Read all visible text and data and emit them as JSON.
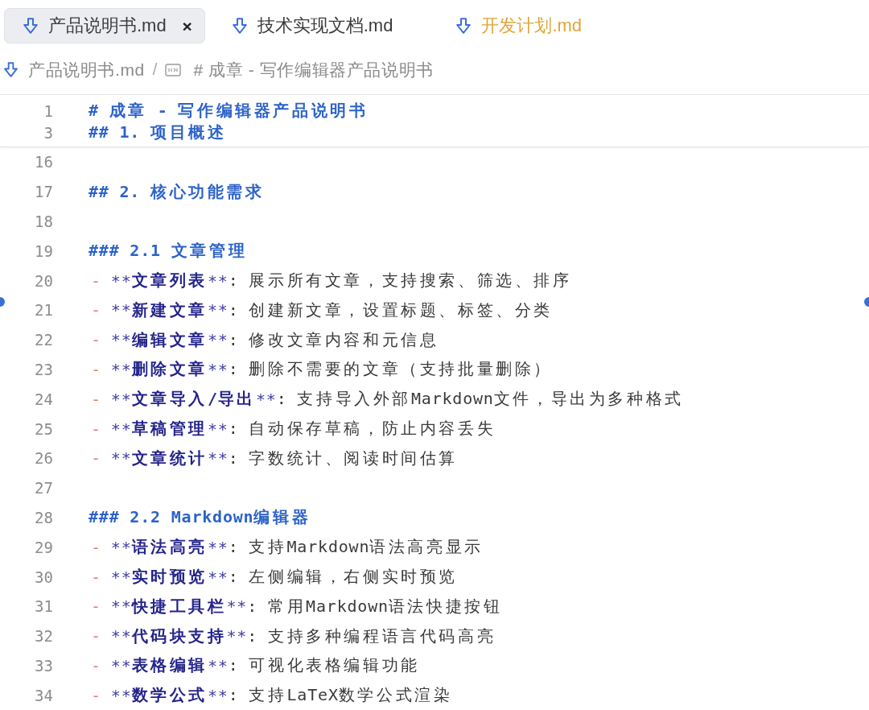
{
  "tabs": [
    {
      "label": "产品说明书.md",
      "selected": true,
      "modified": false,
      "close": "×"
    },
    {
      "label": "技术实现文档.md",
      "selected": false,
      "modified": false
    },
    {
      "label": "开发计划.md",
      "selected": false,
      "modified": true
    }
  ],
  "breadcrumb": {
    "separator": "/",
    "items": [
      {
        "kind": "file",
        "text": "产品说明书.md"
      },
      {
        "kind": "symbol",
        "text": "# 成章 - 写作编辑器产品说明书"
      }
    ]
  },
  "editor": {
    "sticky_lines": [
      {
        "number": "1",
        "kind": "heading",
        "text": "# 成章 - 写作编辑器产品说明书"
      },
      {
        "number": "3",
        "kind": "heading",
        "text": "## 1. 项目概述"
      }
    ],
    "lines": [
      {
        "number": "16",
        "kind": "blank"
      },
      {
        "number": "17",
        "kind": "heading",
        "text": "## 2. 核心功能需求"
      },
      {
        "number": "18",
        "kind": "blank"
      },
      {
        "number": "19",
        "kind": "heading",
        "text": "### 2.1 文章管理"
      },
      {
        "number": "20",
        "kind": "bullet",
        "marker": "-",
        "open": "**",
        "term": "文章列表",
        "close": "**",
        "text": ": 展示所有文章，支持搜索、筛选、排序"
      },
      {
        "number": "21",
        "kind": "bullet",
        "marker": "-",
        "open": "**",
        "term": "新建文章",
        "close": "**",
        "text": ": 创建新文章，设置标题、标签、分类"
      },
      {
        "number": "22",
        "kind": "bullet",
        "marker": "-",
        "open": "**",
        "term": "编辑文章",
        "close": "**",
        "text": ": 修改文章内容和元信息"
      },
      {
        "number": "23",
        "kind": "bullet",
        "marker": "-",
        "open": "**",
        "term": "删除文章",
        "close": "**",
        "text": ": 删除不需要的文章（支持批量删除）"
      },
      {
        "number": "24",
        "kind": "bullet",
        "marker": "-",
        "open": "**",
        "term": "文章导入/导出",
        "close": "**",
        "text": ": 支持导入外部Markdown文件，导出为多种格式"
      },
      {
        "number": "25",
        "kind": "bullet",
        "marker": "-",
        "open": "**",
        "term": "草稿管理",
        "close": "**",
        "text": ": 自动保存草稿，防止内容丢失"
      },
      {
        "number": "26",
        "kind": "bullet",
        "marker": "-",
        "open": "**",
        "term": "文章统计",
        "close": "**",
        "text": ": 字数统计、阅读时间估算"
      },
      {
        "number": "27",
        "kind": "blank"
      },
      {
        "number": "28",
        "kind": "heading",
        "text": "### 2.2 Markdown编辑器"
      },
      {
        "number": "29",
        "kind": "bullet",
        "marker": "-",
        "open": "**",
        "term": "语法高亮",
        "close": "**",
        "text": ": 支持Markdown语法高亮显示"
      },
      {
        "number": "30",
        "kind": "bullet",
        "marker": "-",
        "open": "**",
        "term": "实时预览",
        "close": "**",
        "text": ": 左侧编辑，右侧实时预览"
      },
      {
        "number": "31",
        "kind": "bullet",
        "marker": "-",
        "open": "**",
        "term": "快捷工具栏",
        "close": "**",
        "text": ": 常用Markdown语法快捷按钮"
      },
      {
        "number": "32",
        "kind": "bullet",
        "marker": "-",
        "open": "**",
        "term": "代码块支持",
        "close": "**",
        "text": ": 支持多种编程语言代码高亮"
      },
      {
        "number": "33",
        "kind": "bullet",
        "marker": "-",
        "open": "**",
        "term": "表格编辑",
        "close": "**",
        "text": ": 可视化表格编辑功能"
      },
      {
        "number": "34",
        "kind": "bullet",
        "marker": "-",
        "open": "**",
        "term": "数学公式",
        "close": "**",
        "text": ": 支持LaTeX数学公式渲染"
      }
    ]
  }
}
